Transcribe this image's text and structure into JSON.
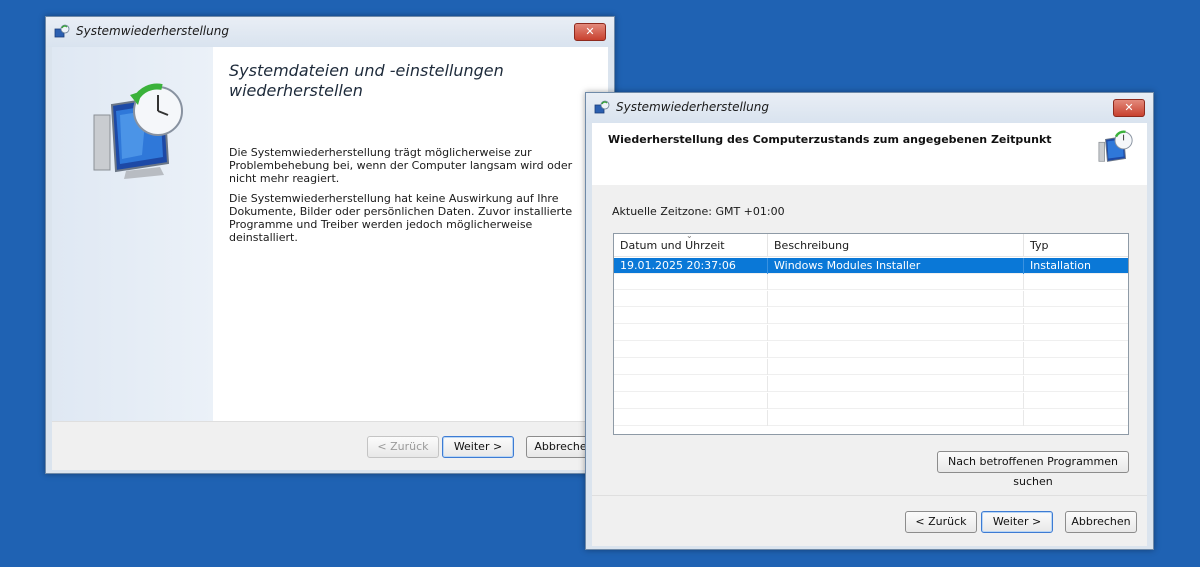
{
  "back_window": {
    "title": "Systemwiederherstellung",
    "heading": "Systemdateien und -einstellungen wiederherstellen",
    "para1": "Die Systemwiederherstellung trägt möglicherweise zur Problembehebung bei, wenn der Computer langsam wird oder nicht mehr reagiert.",
    "para2": "Die Systemwiederherstellung hat keine Auswirkung auf Ihre Dokumente, Bilder oder persönlichen Daten. Zuvor installierte Programme und Treiber werden jedoch möglicherweise deinstalliert.",
    "buttons": {
      "back": "< Zurück",
      "next": "Weiter >",
      "cancel": "Abbrechen"
    }
  },
  "front_window": {
    "title": "Systemwiederherstellung",
    "header": "Wiederherstellung des Computerzustands zum angegebenen Zeitpunkt",
    "timezone": "Aktuelle Zeitzone: GMT +01:00",
    "table": {
      "columns": [
        "Datum und Uhrzeit",
        "Beschreibung",
        "Typ"
      ],
      "rows": [
        {
          "date": "19.01.2025 20:37:06",
          "description": "Windows Modules Installer",
          "type": "Installation",
          "selected": true
        }
      ]
    },
    "scan_button": "Nach betroffenen Programmen suchen",
    "buttons": {
      "back": "< Zurück",
      "next": "Weiter >",
      "cancel": "Abbrechen"
    }
  },
  "icons": {
    "window_icon": "system-restore-icon",
    "close": "close-icon",
    "hero": "system-restore-hero-icon"
  }
}
